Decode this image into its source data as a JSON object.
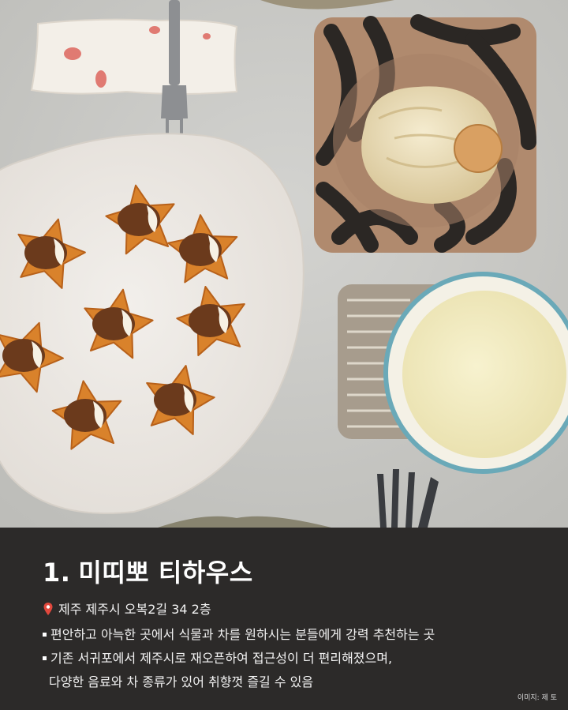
{
  "photo": {
    "description_icon": "food-photo",
    "colors": {
      "table": "#c9c9c6",
      "plate": "#efece8",
      "apricot": "#d9822b",
      "walnut": "#6b3a1c",
      "cream": "#f6f1e4",
      "bowl_stripe_dark": "#2b2724",
      "bowl_stripe_light": "#b08a6e",
      "cup_rim": "#6aa9b8",
      "latte": "#f1ebbf"
    }
  },
  "caption": {
    "number": "1.",
    "title": "미띠뽀 티하우스",
    "location_icon": "pin-icon",
    "location": "제주 제주시 오복2길 34 2층",
    "bullet1": "편안하고 아늑한 곳에서 식물과 차를 원하시는 분들에게 강력 추천하는 곳",
    "bullet2": "기존 서귀포에서 제주시로 재오픈하여 접근성이 더 편리해졌으며,",
    "bullet2_cont": "다양한 음료와 차 종류가 있어 취향껏 즐길 수 있음",
    "credit": "이미지: 제 토"
  }
}
